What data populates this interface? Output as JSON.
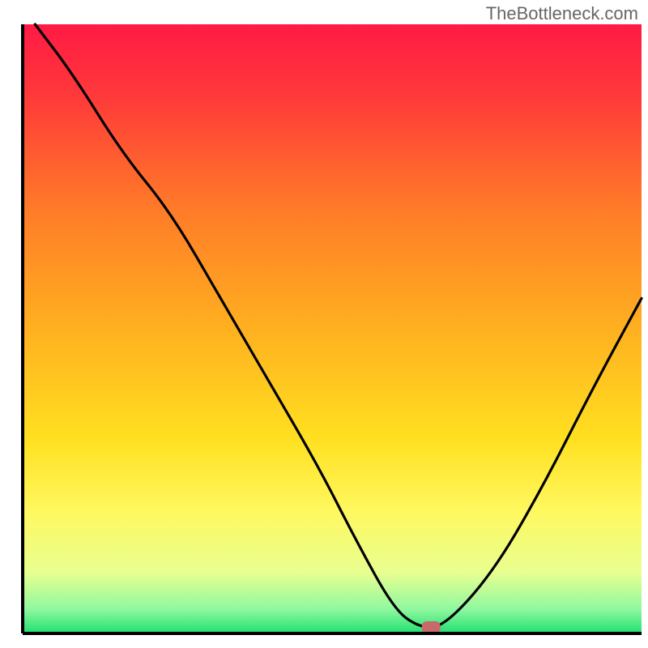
{
  "watermark": "TheBottleneck.com",
  "chart_data": {
    "type": "line",
    "title": "",
    "xlabel": "",
    "ylabel": "",
    "xlim": [
      0,
      100
    ],
    "ylim": [
      0,
      100
    ],
    "background_gradient": {
      "stops": [
        {
          "offset": 0.0,
          "color": "#ff1a44"
        },
        {
          "offset": 0.12,
          "color": "#ff3a3a"
        },
        {
          "offset": 0.3,
          "color": "#ff7a28"
        },
        {
          "offset": 0.5,
          "color": "#ffb020"
        },
        {
          "offset": 0.68,
          "color": "#ffe020"
        },
        {
          "offset": 0.8,
          "color": "#fff860"
        },
        {
          "offset": 0.9,
          "color": "#e8ff90"
        },
        {
          "offset": 0.96,
          "color": "#90f8a0"
        },
        {
          "offset": 1.0,
          "color": "#20e070"
        }
      ]
    },
    "series": [
      {
        "name": "bottleneck-curve",
        "type": "line",
        "color": "#000000",
        "x": [
          2,
          8,
          16,
          24,
          32,
          40,
          48,
          54,
          60,
          64,
          68,
          76,
          84,
          92,
          100
        ],
        "y": [
          100,
          92,
          79,
          69,
          55,
          41,
          27,
          15,
          4,
          1,
          1,
          10,
          24,
          40,
          55
        ]
      }
    ],
    "marker": {
      "name": "optimal-point",
      "x": 66,
      "y": 1,
      "color": "#c96a6a",
      "width": 3,
      "height": 2
    },
    "axes": {
      "color": "#000000",
      "width": 4
    }
  }
}
